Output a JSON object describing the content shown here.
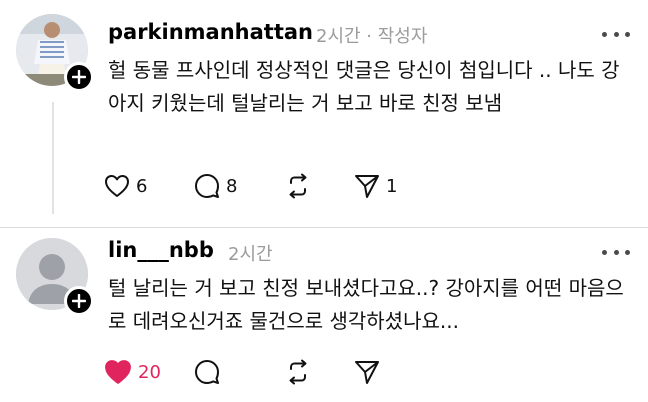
{
  "posts": [
    {
      "username": "parkinmanhattan",
      "meta": "2시간 · 작성자",
      "body": "헐 동물 프사인데 정상적인 댓글은 당신이 첨입니다 .. 나도 강아지 키웠는데 털날리는 거 보고 바로 친정 보냄",
      "likes": "6",
      "replies": "8",
      "reposts": "",
      "shares": "1",
      "liked": false
    },
    {
      "username": "lin___nbb",
      "meta": "2시간",
      "body": "털 날리는 거 보고 친정 보내셨다고요..? 강아지를 어떤 마음으로 데려오신거죠 물건으로 생각하셨나요...",
      "likes": "20",
      "replies": "",
      "reposts": "",
      "shares": "",
      "liked": true
    }
  ],
  "colors": {
    "like_active": "#e0245e",
    "icon": "#111111",
    "meta": "#9b9b9b"
  },
  "icons": [
    "heart-icon",
    "comment-icon",
    "repost-icon",
    "send-icon",
    "plus-icon",
    "more-icon"
  ]
}
